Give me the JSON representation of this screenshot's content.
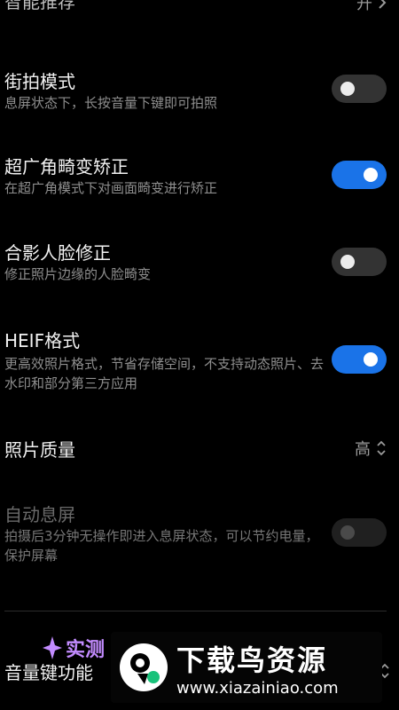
{
  "top_item": {
    "title": "智能推荐",
    "value": "开"
  },
  "items": [
    {
      "title": "街拍模式",
      "subtitle": "息屏状态下，长按音量下键即可拍照",
      "state": "off"
    },
    {
      "title": "超广角畸变矫正",
      "subtitle": "在超广角模式下对画面畸变进行矫正",
      "state": "on"
    },
    {
      "title": "合影人脸修正",
      "subtitle": "修正照片边缘的人脸畸变",
      "state": "off"
    },
    {
      "title": "HEIF格式",
      "subtitle": "更高效照片格式，节省存储空间，不支持动态照片、去水印和部分第三方应用",
      "state": "on"
    }
  ],
  "photo_quality": {
    "title": "照片质量",
    "value": "高"
  },
  "auto_screen_off": {
    "title": "自动息屏",
    "subtitle": "拍摄后3分钟无操作即进入息屏状态，可以节约电量，保护屏幕",
    "state": "disabled-off"
  },
  "volume_key": {
    "title": "音量键功能"
  },
  "watermark": {
    "badge": "实测",
    "title": "下载鸟资源",
    "url": "www.xiazainiao.com"
  },
  "colors": {
    "toggle_on": "#1a73e8",
    "background": "#000000"
  }
}
